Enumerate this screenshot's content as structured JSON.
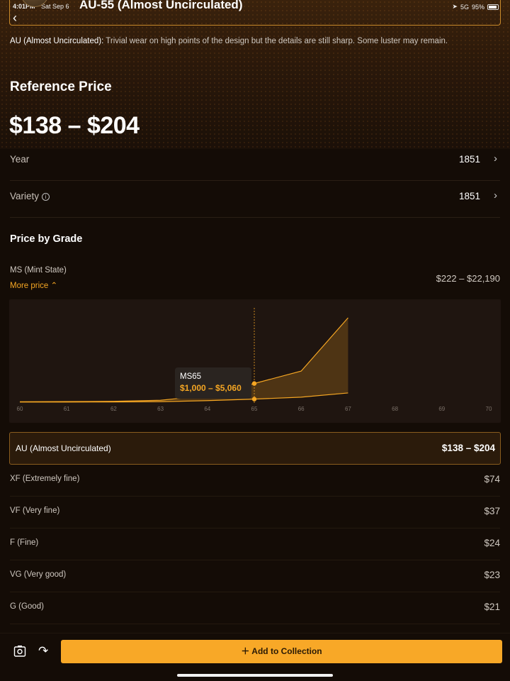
{
  "status_bar": {
    "time": "4:01PM",
    "date": "Sat Sep 6",
    "signal": "5G",
    "battery": "95%"
  },
  "nav": {
    "title": "AU-55 (Almost Uncirculated)"
  },
  "grade_description": {
    "term": "AU (Almost Uncirculated):",
    "text": " Trivial wear on high points of the design but the details are still sharp. Some luster may remain."
  },
  "reference": {
    "label": "Reference Price",
    "price": "$138 – $204"
  },
  "details": [
    {
      "label": "Year",
      "value": "1851"
    },
    {
      "label": "Variety",
      "value": "1851"
    }
  ],
  "price_by_grade": {
    "title": "Price by Grade",
    "ms_label": "MS (Mint State)",
    "more_price": "More price",
    "ms_range": "$222 – $22,190",
    "tooltip": {
      "grade": "MS65",
      "range": "$1,000 – $5,060"
    },
    "x_ticks": [
      "60",
      "61",
      "62",
      "63",
      "64",
      "65",
      "66",
      "67",
      "68",
      "69",
      "70"
    ],
    "highlight": {
      "label": "AU (Almost Uncirculated)",
      "value": "$138 – $204"
    },
    "grades": [
      {
        "label": "XF (Extremely fine)",
        "value": "$74"
      },
      {
        "label": "VF (Very fine)",
        "value": "$37"
      },
      {
        "label": "F (Fine)",
        "value": "$24"
      },
      {
        "label": "VG (Very good)",
        "value": "$23"
      },
      {
        "label": "G (Good)",
        "value": "$21"
      }
    ]
  },
  "chart_data": {
    "type": "area",
    "x": [
      60,
      61,
      62,
      63,
      64,
      65,
      66,
      67
    ],
    "series": [
      {
        "values": [
          222,
          230,
          250,
          320,
          600,
          1000,
          1500,
          2600
        ]
      },
      {
        "values": [
          300,
          340,
          420,
          700,
          1900,
          5060,
          8300,
          22190
        ]
      }
    ],
    "xlim": [
      60,
      70
    ],
    "highlight_x": 65,
    "accent": "#f5a623"
  },
  "bottom": {
    "add_label": "Add to Collection"
  },
  "colors": {
    "accent": "#f8a827",
    "background": "#140c06"
  }
}
